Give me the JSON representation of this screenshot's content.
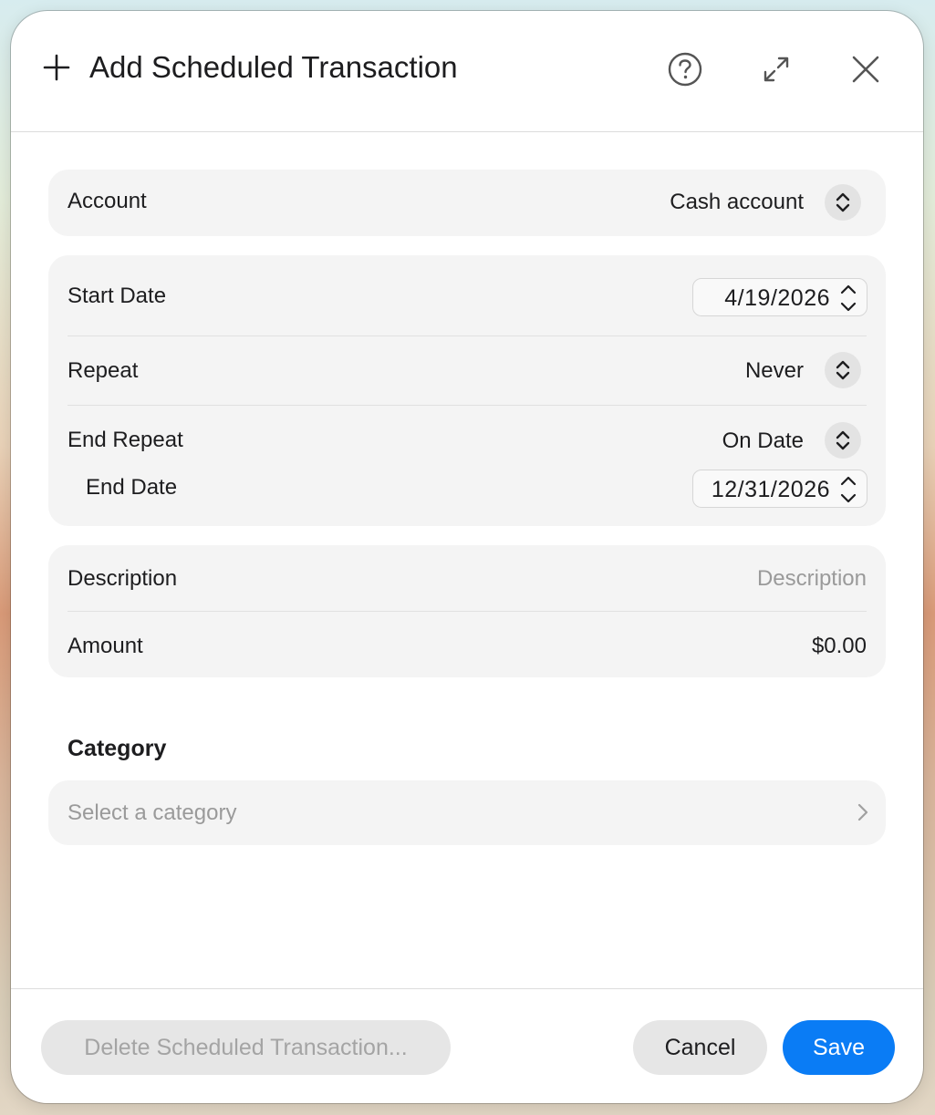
{
  "header": {
    "title": "Add Scheduled Transaction",
    "icons": {
      "add": "plus-icon",
      "help": "question-circle-icon",
      "expand": "expand-arrows-icon",
      "close": "close-icon"
    }
  },
  "account": {
    "label": "Account",
    "value": "Cash account"
  },
  "schedule": {
    "start_date_label": "Start Date",
    "start_date_value": "4/19/2026",
    "repeat_label": "Repeat",
    "repeat_value": "Never",
    "end_repeat_label": "End Repeat",
    "end_repeat_value": "On Date",
    "end_date_label": "End Date",
    "end_date_value": "12/31/2026"
  },
  "details": {
    "description_label": "Description",
    "description_placeholder": "Description",
    "description_value": "",
    "amount_label": "Amount",
    "amount_value": "$0.00"
  },
  "category": {
    "title": "Category",
    "placeholder": "Select a category"
  },
  "footer": {
    "delete_label": "Delete Scheduled Transaction...",
    "cancel_label": "Cancel",
    "save_label": "Save"
  },
  "colors": {
    "accent": "#0a7cf5",
    "card_background": "#f4f4f4",
    "placeholder_text": "#9a9a9a"
  }
}
